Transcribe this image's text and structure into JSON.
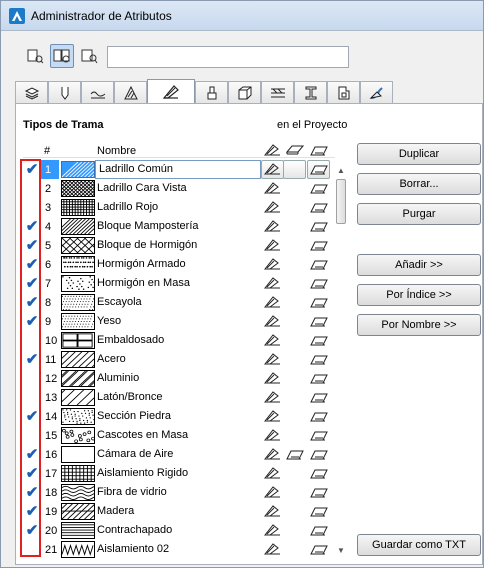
{
  "window": {
    "title": "Administrador de Atributos"
  },
  "toolbar": {
    "buttons": [
      {
        "icon": "view-list-icon",
        "active": false
      },
      {
        "icon": "view-columns-icon",
        "active": true
      },
      {
        "icon": "view-details-icon",
        "active": false
      }
    ],
    "search": {
      "value": "",
      "placeholder": ""
    }
  },
  "tabs": [
    {
      "icon": "layers-icon",
      "active": false
    },
    {
      "icon": "pen-icon",
      "active": false
    },
    {
      "icon": "line-type-icon",
      "active": false
    },
    {
      "icon": "fill-hatch-icon",
      "active": true
    },
    {
      "icon": "paint-brush-icon",
      "active": false
    },
    {
      "icon": "building-material-icon",
      "active": false
    },
    {
      "icon": "profile-icon",
      "active": false
    },
    {
      "icon": "i-beam-icon",
      "active": false
    },
    {
      "icon": "zone-category-icon",
      "active": false
    },
    {
      "icon": "surface-material-icon",
      "active": false
    }
  ],
  "list": {
    "heading": "Tipos de Trama",
    "in_project_label": "en el Proyecto",
    "columns": {
      "num": "#",
      "name": "Nombre"
    },
    "rows": [
      {
        "num": "1",
        "name": "Ladrillo Común",
        "checked": true,
        "pattern": "diag-blue",
        "selected": true,
        "uses": [
          "fill",
          "blank",
          "surface"
        ]
      },
      {
        "num": "2",
        "name": "Ladrillo Cara Vista",
        "checked": false,
        "pattern": "crosshatch-dense",
        "uses": [
          "fill",
          "",
          "surface"
        ]
      },
      {
        "num": "3",
        "name": "Ladrillo Rojo",
        "checked": false,
        "pattern": "grid-dense",
        "uses": [
          "fill",
          "",
          "surface"
        ]
      },
      {
        "num": "4",
        "name": "Bloque Mampostería",
        "checked": true,
        "pattern": "block",
        "uses": [
          "fill",
          "",
          "surface"
        ]
      },
      {
        "num": "5",
        "name": "Bloque de Hormigón",
        "checked": true,
        "pattern": "cross",
        "uses": [
          "fill",
          "",
          "surface"
        ]
      },
      {
        "num": "6",
        "name": "Hormigón Armado",
        "checked": true,
        "pattern": "dots",
        "uses": [
          "fill",
          "",
          "surface"
        ]
      },
      {
        "num": "7",
        "name": "Hormigón en Masa",
        "checked": true,
        "pattern": "dots-sparse",
        "uses": [
          "fill",
          "",
          "surface"
        ]
      },
      {
        "num": "8",
        "name": "Escayola",
        "checked": true,
        "pattern": "fine-dots",
        "uses": [
          "fill",
          "",
          "surface"
        ]
      },
      {
        "num": "9",
        "name": "Yeso",
        "checked": true,
        "pattern": "fine-dots2",
        "uses": [
          "fill",
          "",
          "surface"
        ]
      },
      {
        "num": "10",
        "name": "Embaldosado",
        "checked": false,
        "pattern": "tiles",
        "uses": [
          "fill",
          "",
          "surface"
        ]
      },
      {
        "num": "11",
        "name": "Acero",
        "checked": true,
        "pattern": "diag",
        "uses": [
          "fill",
          "",
          "surface"
        ]
      },
      {
        "num": "12",
        "name": "Aluminio",
        "checked": false,
        "pattern": "diag-double",
        "uses": [
          "fill",
          "",
          "surface"
        ]
      },
      {
        "num": "13",
        "name": "Latón/Bronce",
        "checked": false,
        "pattern": "diag-wide",
        "uses": [
          "fill",
          "",
          "surface"
        ]
      },
      {
        "num": "14",
        "name": "Sección Piedra",
        "checked": true,
        "pattern": "stone",
        "uses": [
          "fill",
          "",
          "surface"
        ]
      },
      {
        "num": "15",
        "name": "Cascotes en Masa",
        "checked": false,
        "pattern": "rubble",
        "uses": [
          "fill",
          "",
          "surface"
        ]
      },
      {
        "num": "16",
        "name": "Cámara de Aire",
        "checked": true,
        "pattern": "empty",
        "uses": [
          "fill",
          "surface",
          "surface"
        ]
      },
      {
        "num": "17",
        "name": "Aislamiento Rigido",
        "checked": true,
        "pattern": "grid",
        "uses": [
          "fill",
          "",
          "surface"
        ]
      },
      {
        "num": "18",
        "name": "Fibra de vidrio",
        "checked": true,
        "pattern": "wave",
        "uses": [
          "fill",
          "",
          "surface"
        ]
      },
      {
        "num": "19",
        "name": "Madera",
        "checked": true,
        "pattern": "wood",
        "uses": [
          "fill",
          "",
          "surface"
        ]
      },
      {
        "num": "20",
        "name": "Contrachapado",
        "checked": true,
        "pattern": "hlines",
        "uses": [
          "fill",
          "",
          "surface"
        ]
      },
      {
        "num": "21",
        "name": "Aislamiento 02",
        "checked": false,
        "pattern": "zigzag",
        "uses": [
          "fill",
          "",
          "surface"
        ]
      }
    ]
  },
  "buttons": {
    "duplicar": "Duplicar",
    "borrar": "Borrar...",
    "purgar": "Purgar",
    "anadir": "Añadir >>",
    "por_indice": "Por Índice >>",
    "por_nombre": "Por Nombre >>",
    "guardar_txt": "Guardar como TXT"
  },
  "colors": {
    "selection": "#3399ff",
    "highlight_frame": "#e0201f",
    "check": "#1a5fb4"
  }
}
